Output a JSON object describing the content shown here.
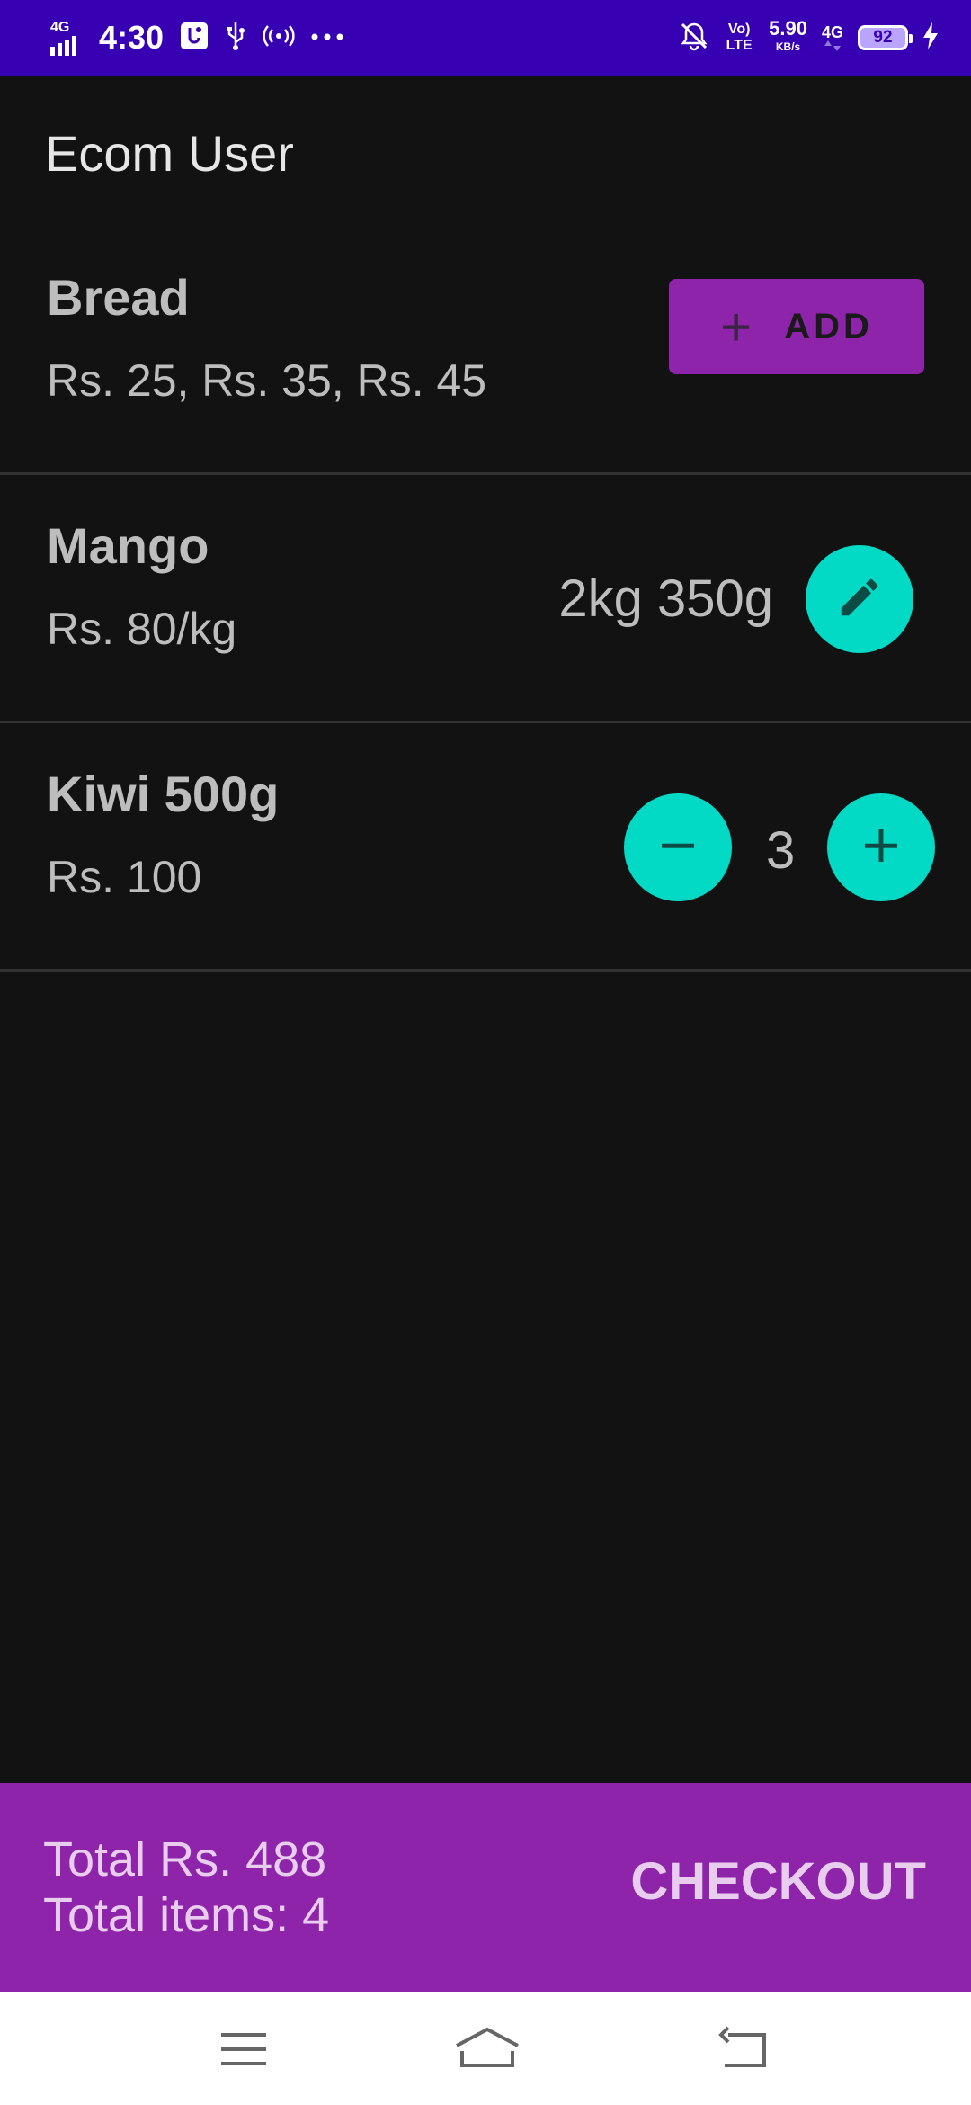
{
  "status_bar": {
    "network_label": "4G",
    "time": "4:30",
    "volte_label": "Vo) LTE",
    "speed_value": "5.90",
    "speed_unit": "KB/s",
    "network_label_right": "4G",
    "battery_level": "92"
  },
  "app": {
    "title": "Ecom User"
  },
  "items": [
    {
      "name": "Bread",
      "price": "Rs. 25,  Rs. 35,  Rs. 45",
      "add_label": "ADD"
    },
    {
      "name": "Mango",
      "price": "Rs. 80/kg",
      "quantity": "2kg 350g"
    },
    {
      "name": "Kiwi 500g",
      "price": "Rs. 100",
      "count": "3"
    }
  ],
  "summary": {
    "total_price": "Total Rs. 488",
    "total_items": "Total items: 4",
    "checkout_label": "CHECKOUT"
  },
  "colors": {
    "status_bar": "#3700B3",
    "primary": "#8E24AA",
    "accent": "#03DAC5",
    "background": "#121212"
  }
}
